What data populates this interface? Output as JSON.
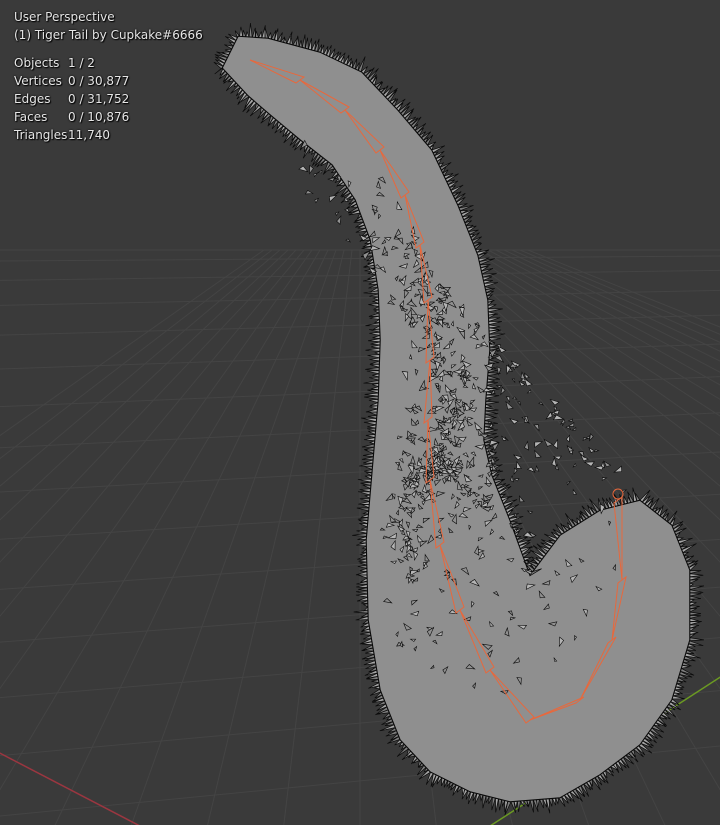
{
  "viewport": {
    "view_name": "User Perspective",
    "object_name": "(1) Tiger Tail by Cupkake#6666",
    "colors": {
      "background": "#3a3a3a",
      "grid": "#444444",
      "x_axis": "#9b3640",
      "y_axis": "#6b9a22",
      "fur_fill": "#8f8f8f",
      "fur_edge": "#0a0a0a",
      "bone_color": "#e8683c"
    }
  },
  "stats": [
    {
      "label": "Objects",
      "value": "1 / 2"
    },
    {
      "label": "Vertices",
      "value": "0 / 30,877"
    },
    {
      "label": "Edges",
      "value": "0 / 31,752"
    },
    {
      "label": "Faces",
      "value": "0 / 10,876"
    },
    {
      "label": "Triangles",
      "value": "11,740"
    }
  ]
}
